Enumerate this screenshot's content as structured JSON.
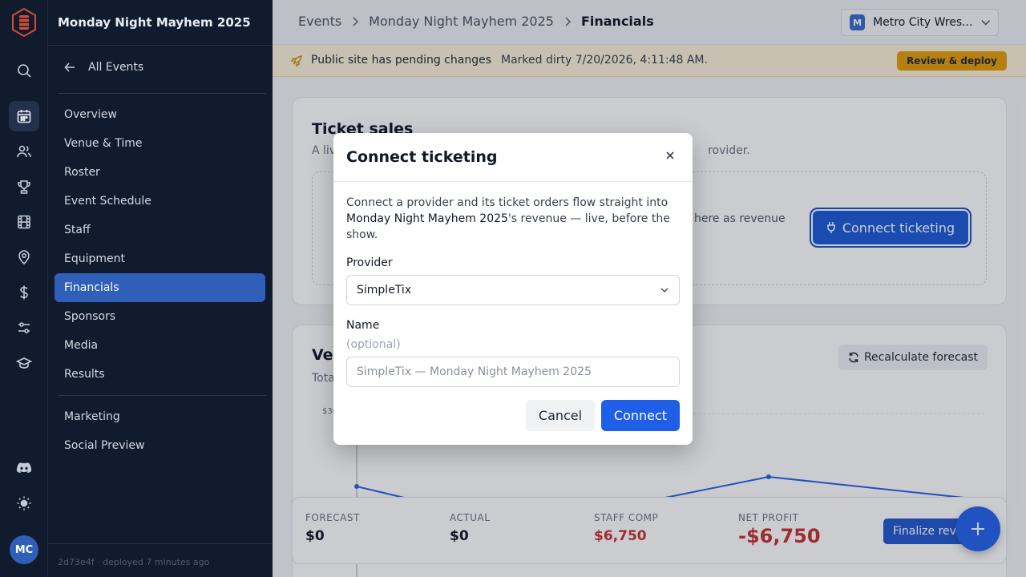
{
  "sidebar": {
    "event_title": "Monday Night Mayhem 2025",
    "back_label": "All Events",
    "items": [
      {
        "label": "Overview"
      },
      {
        "label": "Venue & Time"
      },
      {
        "label": "Roster"
      },
      {
        "label": "Event Schedule"
      },
      {
        "label": "Staff"
      },
      {
        "label": "Equipment"
      },
      {
        "label": "Financials",
        "active": true
      },
      {
        "label": "Sponsors"
      },
      {
        "label": "Media"
      },
      {
        "label": "Results"
      }
    ],
    "secondary_items": [
      {
        "label": "Marketing"
      },
      {
        "label": "Social Preview"
      }
    ],
    "footer": "2d73e4f · deployed 7 minutes ago"
  },
  "rail": {
    "icons": [
      "logo-icon",
      "search-icon",
      "calendar-icon",
      "users-icon",
      "trophy-icon",
      "film-icon",
      "map-pin-icon",
      "dollar-icon",
      "sliders-icon",
      "graduation-cap-icon",
      "discord-icon",
      "sun-icon"
    ],
    "avatar_initials": "MC"
  },
  "header": {
    "breadcrumbs": [
      "Events",
      "Monday Night Mayhem 2025",
      "Financials"
    ],
    "org_initial": "M",
    "org_name": "Metro City Wres..."
  },
  "banner": {
    "title": "Public site has pending changes",
    "meta": "Marked dirty 7/20/2026, 4:11:48 AM.",
    "button": "Review & deploy"
  },
  "ticket_sales": {
    "title": "Ticket sales",
    "subtitle_start": "A liv",
    "subtitle_end": "rovider.",
    "dashed_text": "here as revenue",
    "connect_button": "Connect ticketing"
  },
  "venue_card": {
    "title_partial": "Ve",
    "subtitle_partial": "Tota",
    "recalc_button": "Recalculate forecast",
    "axis_partial": "$30"
  },
  "summary": {
    "forecast_label": "FORECAST",
    "forecast_value": "$0",
    "actual_label": "ACTUAL",
    "actual_value": "$0",
    "staff_label": "STAFF COMP",
    "staff_value": "$6,750",
    "net_label": "NET PROFIT",
    "net_value": "-$6,750",
    "finalize_button": "Finalize rev"
  },
  "modal": {
    "title": "Connect ticketing",
    "desc_before": "Connect a provider and its ticket orders flow straight into ",
    "desc_event": "Monday Night Mayhem 2025",
    "desc_after": "'s revenue — live, before the show.",
    "provider_label": "Provider",
    "provider_value": "SimpleTix",
    "name_label": "Name",
    "name_hint": "(optional)",
    "name_placeholder": "SimpleTix — Monday Night Mayhem 2025",
    "cancel": "Cancel",
    "connect": "Connect"
  },
  "colors": {
    "sidebar_bg": "#111b2e",
    "accent": "#1f5ee6",
    "banner_bg": "#fbf0d6",
    "warning_button": "#e59e0b",
    "negative": "#c83232"
  }
}
